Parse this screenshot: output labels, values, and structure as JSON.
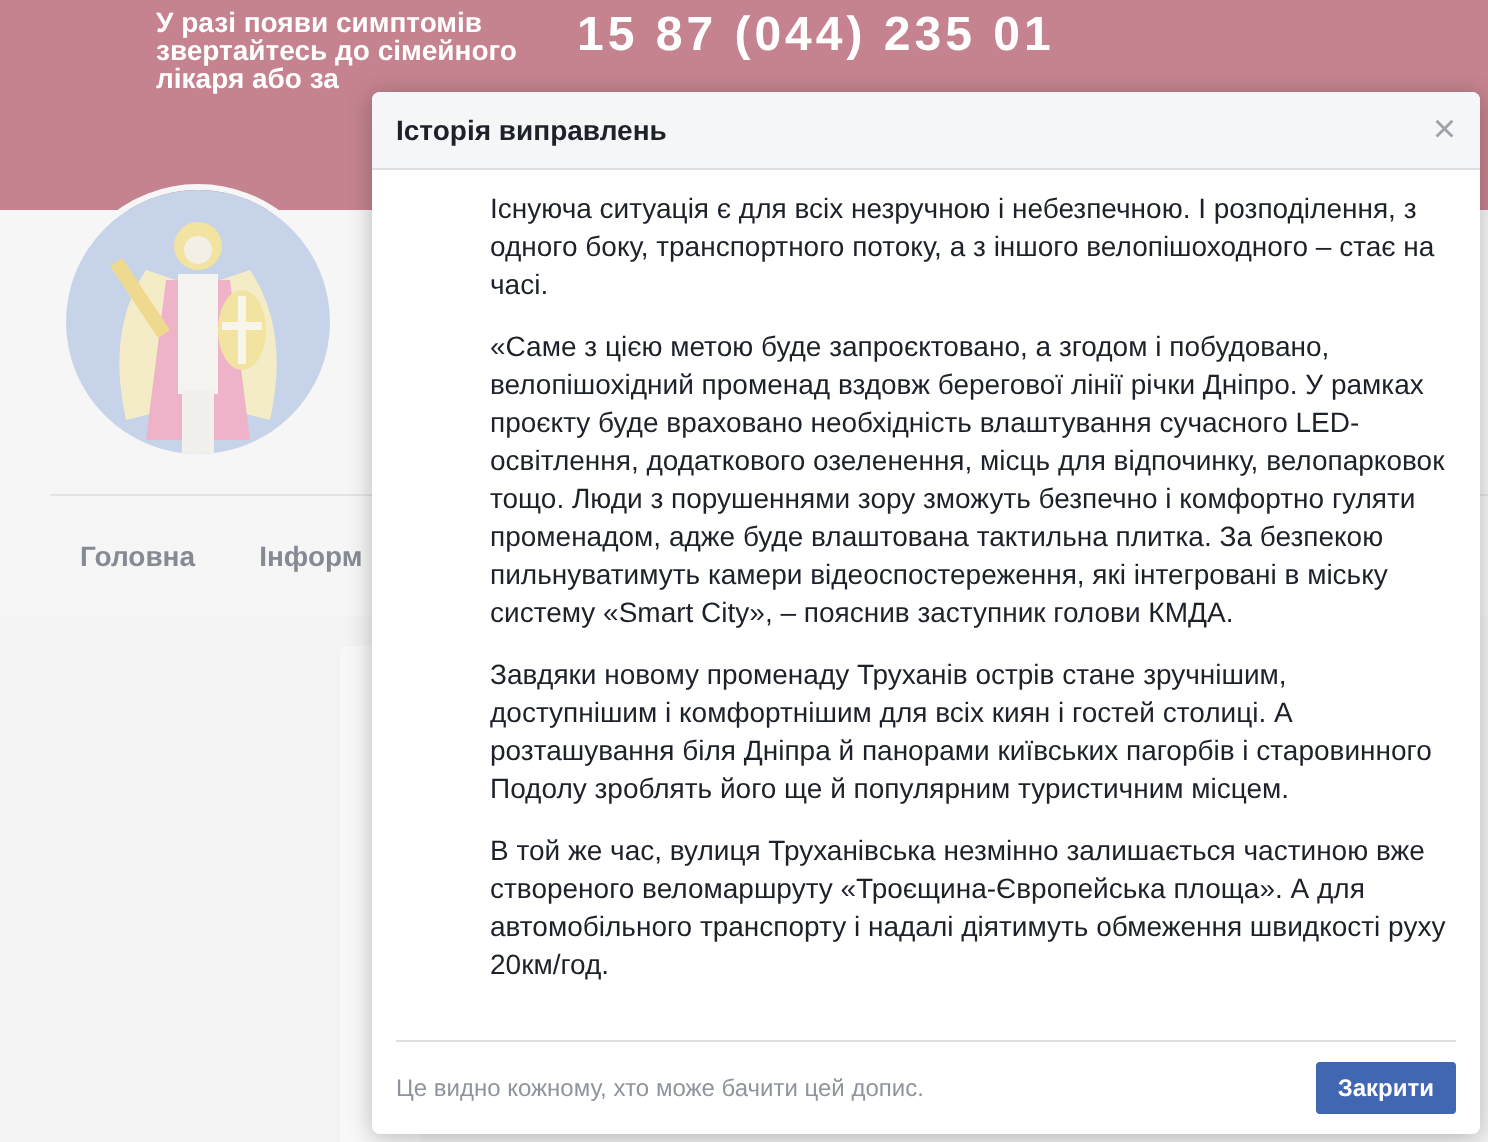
{
  "banner": {
    "notice": [
      "У разі появи симптомів",
      "звертайтесь до сімейного",
      "лікаря або за"
    ],
    "phone": "15 87 (044) 235 01"
  },
  "profile": {
    "nav": [
      {
        "label": "Головна",
        "selected": false
      },
      {
        "label": "Інформ",
        "selected": false
      }
    ]
  },
  "dialog": {
    "title": "Історія виправлень",
    "close": "×",
    "paragraphs": [
      "Існуюча ситуація є для всіх незручною і небезпечною. І розподілення, з одного боку, транспортного потоку, а з іншого велопішоходного – стає на часі.",
      "«Саме з цією метою буде запроєктовано, а згодом і побудовано, велопішохідний променад вздовж берегової лінії річки Дніпро. У рамках проєкту буде враховано необхідність влаштування сучасного LED-освітлення, додаткового озеленення, місць для відпочинку, велопарковок тощо. Люди з порушеннями зору зможуть безпечно і комфортно гуляти променадом, адже буде влаштована тактильна плитка. За безпекою пильнуватимуть камери відеоспостереження, які інтегровані в міську систему «Smart City», – пояснив заступник голови КМДА.",
      "Завдяки новому променаду Труханів острів стане зручнішим, доступнішим і комфортнішим для всіх киян і гостей столиці. А розташування біля Дніпра й панорами київських пагорбів і старовинного Подолу зроблять його ще й популярним туристичним місцем.",
      "В той же час, вулиця Труханівська незмінно залишається частиною вже створеного веломаршруту «Троєщина-Європейська площа». А для автомобільного транспорту і надалі діятимуть обмеження швидкості руху 20км/год."
    ],
    "footer_note": "Це видно кожному, хто може бачити цей допис.",
    "button": "Закрити"
  }
}
